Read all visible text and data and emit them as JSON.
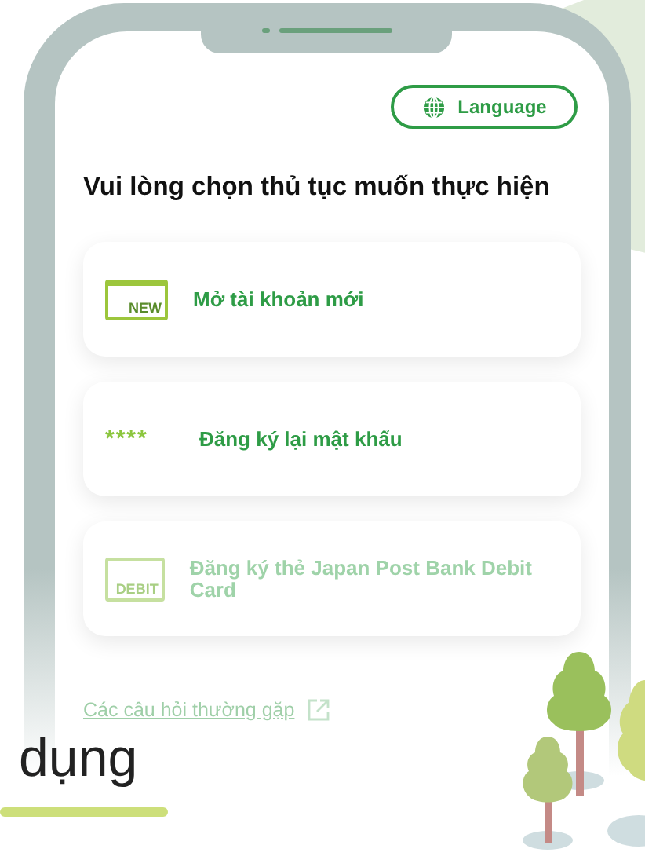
{
  "language_button": {
    "label": "Language"
  },
  "heading": "Vui lòng chọn thủ tục muốn thực hiện",
  "options": [
    {
      "kind": "new-account",
      "label": "Mở tài khoản mới",
      "icon_text": "NEW",
      "disabled": false
    },
    {
      "kind": "password",
      "label": "Đăng ký lại mật khẩu",
      "icon_text": "****",
      "disabled": false
    },
    {
      "kind": "debit",
      "label": "Đăng ký thẻ Japan Post Bank Debit Card",
      "icon_text": "DEBIT",
      "disabled": true
    }
  ],
  "faq_link": "Các câu hỏi thường gặp",
  "caption": "dụng"
}
